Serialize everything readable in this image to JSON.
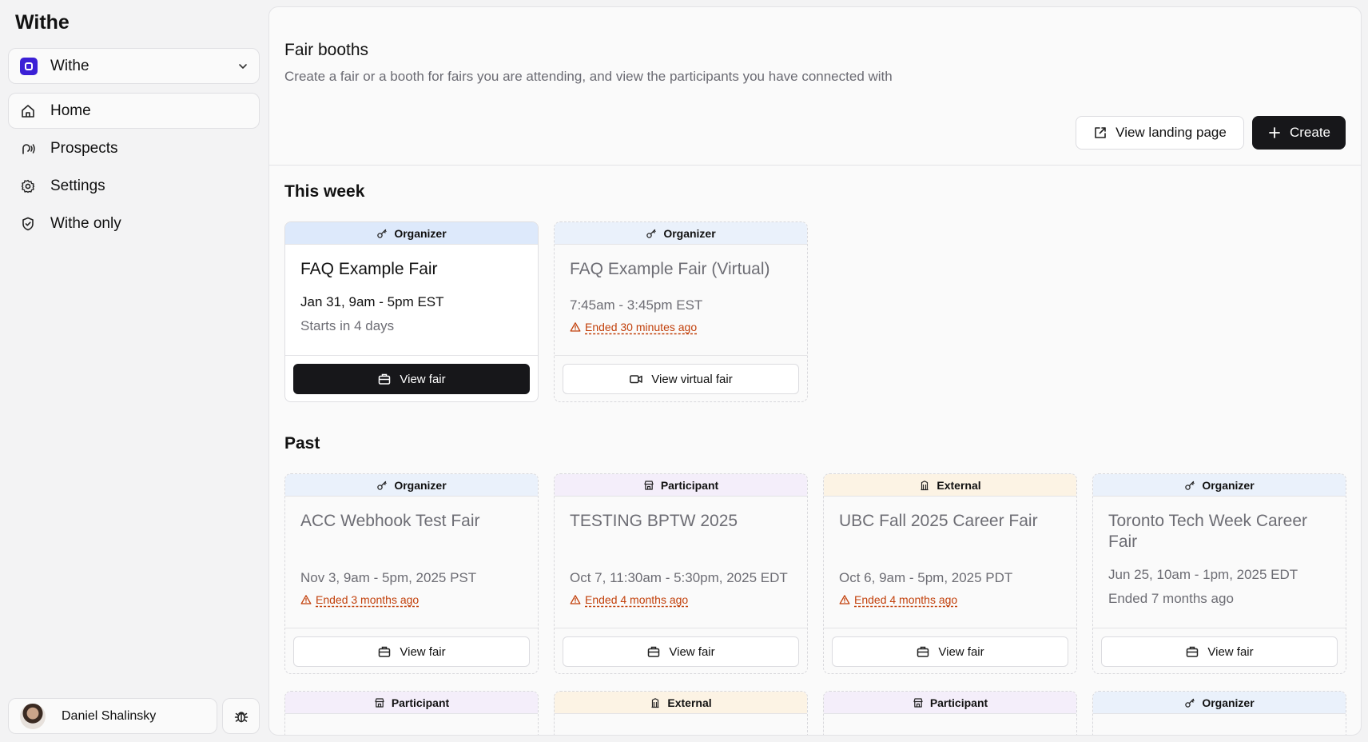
{
  "sidebar": {
    "app_name": "Withe",
    "workspace": {
      "name": "Withe",
      "icon": "workspace-logo"
    },
    "nav": [
      {
        "label": "Home",
        "icon": "home-icon",
        "active": true
      },
      {
        "label": "Prospects",
        "icon": "prospects-icon",
        "active": false
      },
      {
        "label": "Settings",
        "icon": "gear-icon",
        "active": false
      },
      {
        "label": "Withe only",
        "icon": "shield-icon",
        "active": false
      }
    ],
    "user": {
      "name": "Daniel Shalinsky"
    }
  },
  "header": {
    "title": "Fair booths",
    "subtitle": "Create a fair or a booth for fairs you are attending, and view the participants you have connected with",
    "view_landing_label": "View landing page",
    "create_label": "Create"
  },
  "this_week": {
    "title": "This week",
    "cards": [
      {
        "role": "Organizer",
        "title": "FAQ Example Fair",
        "date": "Jan 31, 9am - 5pm EST",
        "status": "Starts in 4 days",
        "button": "View fair"
      },
      {
        "role": "Organizer",
        "title": "FAQ Example Fair (Virtual)",
        "date": "7:45am - 3:45pm EST",
        "warning": "Ended 30 minutes ago",
        "button": "View virtual fair"
      }
    ]
  },
  "past": {
    "title": "Past",
    "cards": [
      {
        "role": "Organizer",
        "title": "ACC Webhook Test Fair",
        "date": "Nov 3, 9am - 5pm, 2025 PST",
        "warning": "Ended 3 months ago",
        "button": "View fair"
      },
      {
        "role": "Participant",
        "title": "TESTING BPTW 2025",
        "date": "Oct 7, 11:30am - 5:30pm, 2025 EDT",
        "warning": "Ended 4 months ago",
        "button": "View fair"
      },
      {
        "role": "External",
        "title": "UBC Fall 2025 Career Fair",
        "date": "Oct 6, 9am - 5pm, 2025 PDT",
        "warning": "Ended 4 months ago",
        "button": "View fair"
      },
      {
        "role": "Organizer",
        "title": "Toronto Tech Week Career Fair",
        "date": "Jun 25, 10am - 1pm, 2025 EDT",
        "status": "Ended 7 months ago",
        "button": "View fair"
      }
    ],
    "next_row_roles": [
      "Participant",
      "External",
      "Participant",
      "Organizer"
    ]
  },
  "colors": {
    "accent": "#3b20d6",
    "primary_button": "#17171a",
    "warning": "#c2410c",
    "organizer_header": "#dde9fb",
    "participant_header": "#f4eefa",
    "external_header": "#fcf3e4"
  }
}
